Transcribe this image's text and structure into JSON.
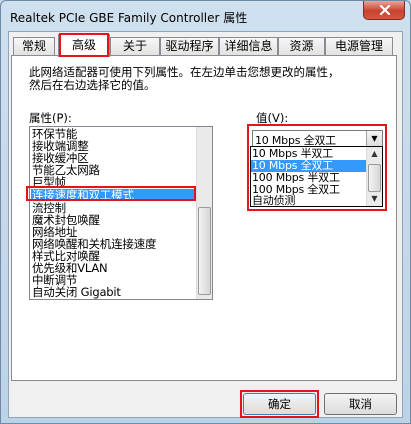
{
  "window": {
    "title": "Realtek PCIe GBE Family Controller 属性"
  },
  "tabs": [
    {
      "label": "常规"
    },
    {
      "label": "高级"
    },
    {
      "label": "关于"
    },
    {
      "label": "驱动程序"
    },
    {
      "label": "详细信息"
    },
    {
      "label": "资源"
    },
    {
      "label": "电源管理"
    }
  ],
  "active_tab": "高级",
  "description": {
    "line1": "此网络适配器可使用下列属性。在左边单击您想更改的属性，",
    "line2": "然后在右边选择它的值。"
  },
  "properties": {
    "label": "属性(P):",
    "items": [
      "环保节能",
      "接收端调整",
      "接收缓冲区",
      "节能乙太网路",
      "巨型帧",
      "连接速度和双工模式",
      "流控制",
      "魔术封包唤醒",
      "网络地址",
      "网络唤醒和关机连接速度",
      "样式比对唤醒",
      "优先级和VLAN",
      "中断调节",
      "自动关闭 Gigabit"
    ],
    "selected": "连接速度和双工模式"
  },
  "value": {
    "label": "值(V):",
    "current": "10 Mbps 全双工",
    "options": [
      "10 Mbps 半双工",
      "10 Mbps 全双工",
      "100 Mbps 半双工",
      "100 Mbps 全双工",
      "自动侦测"
    ],
    "highlighted": "10 Mbps 全双工"
  },
  "buttons": {
    "ok": "确定",
    "cancel": "取消"
  },
  "colors": {
    "highlight": "#3399ff",
    "annotation_red": "#e8121a"
  }
}
